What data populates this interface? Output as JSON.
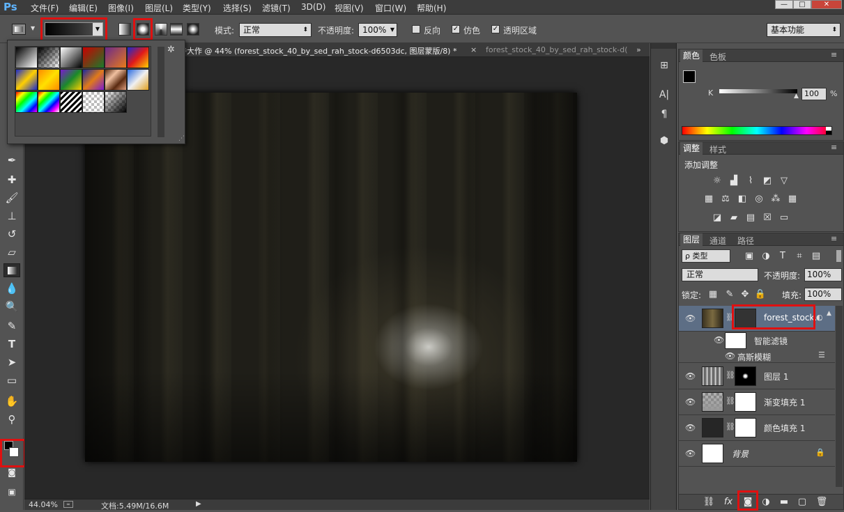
{
  "app": {
    "logo": "Ps"
  },
  "menu": [
    "文件(F)",
    "编辑(E)",
    "图像(I)",
    "图层(L)",
    "类型(Y)",
    "选择(S)",
    "滤镜(T)",
    "3D(D)",
    "视图(V)",
    "窗口(W)",
    "帮助(H)"
  ],
  "window_controls": {
    "minimize": "—",
    "restore": "□",
    "close": "✕"
  },
  "options_bar": {
    "mode_label": "模式:",
    "mode_value": "正常",
    "opacity_label": "不透明度:",
    "opacity_value": "100%",
    "reverse_label": "反向",
    "dither_label": "仿色",
    "transparency_label": "透明区域",
    "workspace": "基本功能",
    "reverse_checked": false,
    "dither_checked": true,
    "transparency_checked": true
  },
  "document_tabs": [
    {
      "label": "待大作 @ 44% (forest_stock_40_by_sed_rah_stock-d6503dc, 图层蒙版/8) *",
      "close": "×",
      "active": true
    },
    {
      "label": "forest_stock_40_by_sed_rah_stock-d(",
      "active": false
    }
  ],
  "tabs_overflow": "»",
  "status": {
    "zoom": "44.04%",
    "doc": "文档:5.49M/16.6M"
  },
  "color_panel": {
    "tabs": [
      "颜色",
      "色板"
    ],
    "channel_label": "K",
    "channel_value": "100",
    "unit": "%"
  },
  "adjustments_panel": {
    "tabs": [
      "调整",
      "样式"
    ],
    "heading": "添加调整"
  },
  "layers_panel": {
    "tabs": [
      "图层",
      "通道",
      "路径"
    ],
    "filter_kind": "ρ 类型",
    "blend_mode": "正常",
    "opacity_label": "不透明度:",
    "opacity_value": "100%",
    "lock_label": "锁定:",
    "fill_label": "填充:",
    "fill_value": "100%",
    "layers": [
      {
        "name": "forest_stock...",
        "selected": true
      },
      {
        "name": "智能滤镜",
        "sub": true
      },
      {
        "name": "高斯模糊",
        "sub": true
      },
      {
        "name": "图层 1"
      },
      {
        "name": "渐变填充 1"
      },
      {
        "name": "颜色填充 1"
      },
      {
        "name": "背景",
        "locked": true
      }
    ]
  },
  "icons": {
    "eye": "eye-icon",
    "lock": "lock-icon",
    "chain": "link-icon",
    "gear": "gear-icon"
  },
  "highlight_color": "#e01010"
}
